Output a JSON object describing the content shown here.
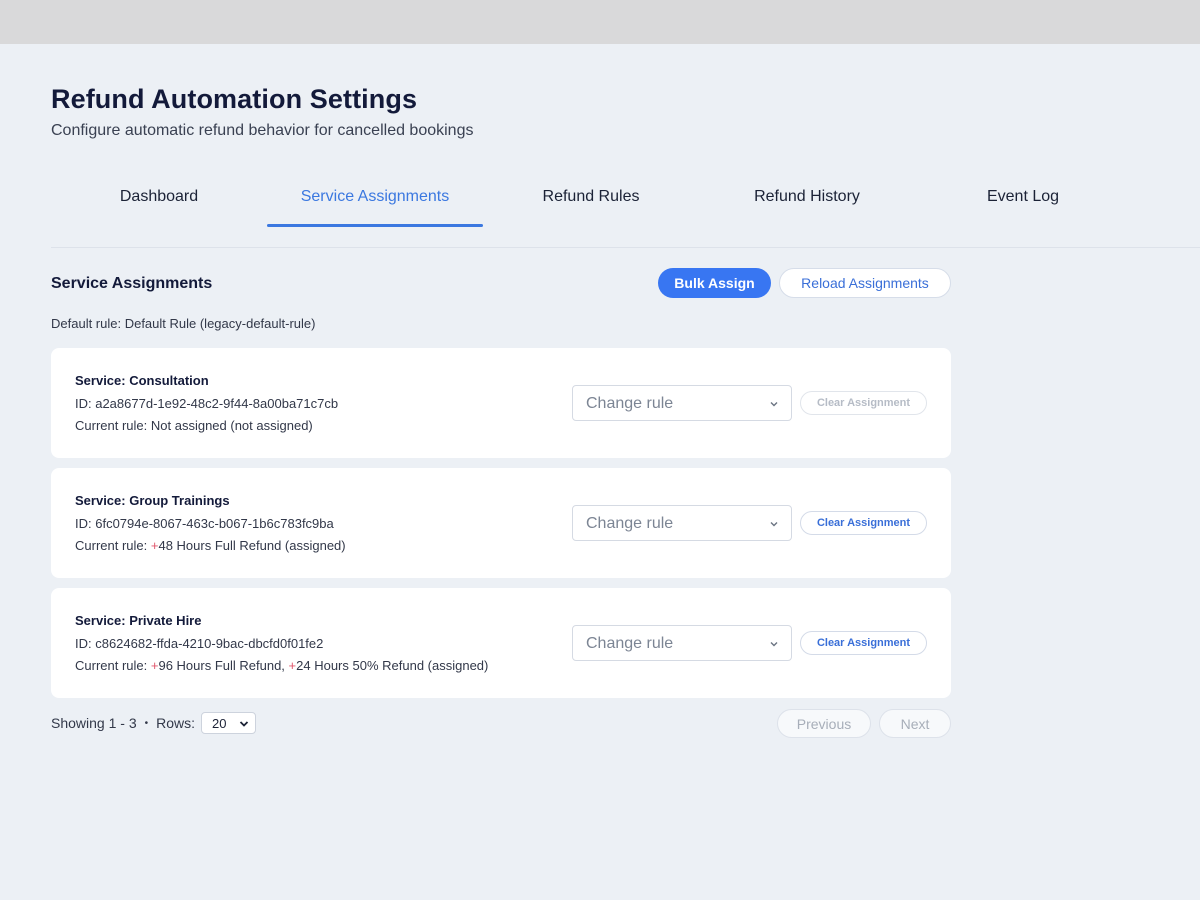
{
  "page": {
    "title": "Refund Automation Settings",
    "subtitle": "Configure automatic refund behavior for cancelled bookings"
  },
  "tabs": [
    {
      "label": "Dashboard",
      "active": false
    },
    {
      "label": "Service Assignments",
      "active": true
    },
    {
      "label": "Refund Rules",
      "active": false
    },
    {
      "label": "Refund History",
      "active": false
    },
    {
      "label": "Event Log",
      "active": false
    }
  ],
  "section": {
    "title": "Service Assignments",
    "bulk_assign_label": "Bulk Assign",
    "reload_label": "Reload Assignments",
    "default_rule": "Default rule: Default Rule (legacy-default-rule)"
  },
  "services": [
    {
      "name": "Service: Consultation",
      "id": "ID: a2a8677d-1e92-48c2-9f44-8a00ba71c7cb",
      "rule_prefix": "Current rule: ",
      "rule_plus_1": "",
      "rule_text_1": "Not assigned (not assigned)",
      "rule_plus_2": "",
      "rule_text_2": "",
      "select_placeholder": "Change rule",
      "clear_label": "Clear Assignment",
      "clear_enabled": false
    },
    {
      "name": "Service: Group Trainings",
      "id": "ID: 6fc0794e-8067-463c-b067-1b6c783fc9ba",
      "rule_prefix": "Current rule: ",
      "rule_plus_1": "+",
      "rule_text_1": "48 Hours Full Refund (assigned)",
      "rule_plus_2": "",
      "rule_text_2": "",
      "select_placeholder": "Change rule",
      "clear_label": "Clear Assignment",
      "clear_enabled": true
    },
    {
      "name": "Service: Private Hire",
      "id": "ID: c8624682-ffda-4210-9bac-dbcfd0f01fe2",
      "rule_prefix": "Current rule: ",
      "rule_plus_1": "+",
      "rule_text_1": "96 Hours Full Refund, ",
      "rule_plus_2": "+",
      "rule_text_2": "24 Hours 50% Refund (assigned)",
      "select_placeholder": "Change rule",
      "clear_label": "Clear Assignment",
      "clear_enabled": true
    }
  ],
  "pagination": {
    "showing": "Showing 1 - 3",
    "dot": "•",
    "rows_label": "Rows:",
    "rows_value": "20",
    "previous_label": "Previous",
    "next_label": "Next"
  },
  "colors": {
    "accent": "#3876f2",
    "tab_active": "#3b78e0",
    "rule_plus": "#e0566b",
    "background": "#ecf0f5"
  }
}
